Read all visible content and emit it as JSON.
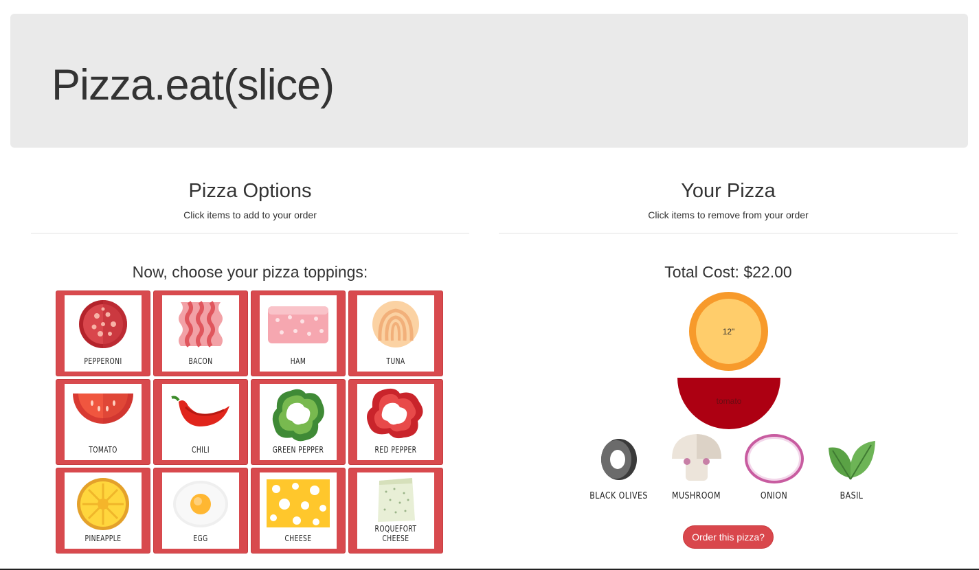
{
  "header": {
    "title": "Pizza.eat(slice)"
  },
  "options": {
    "title": "Pizza Options",
    "subtitle": "Click items to add to your order",
    "prompt": "Now, choose your pizza toppings:",
    "toppings": [
      {
        "label": "PEPPERONI",
        "icon": "pepperoni-icon"
      },
      {
        "label": "BACON",
        "icon": "bacon-icon"
      },
      {
        "label": "HAM",
        "icon": "ham-icon"
      },
      {
        "label": "TUNA",
        "icon": "tuna-icon"
      },
      {
        "label": "TOMATO",
        "icon": "tomato-icon"
      },
      {
        "label": "CHILI",
        "icon": "chili-icon"
      },
      {
        "label": "GREEN PEPPER",
        "icon": "green-pepper-icon"
      },
      {
        "label": "RED PEPPER",
        "icon": "red-pepper-icon"
      },
      {
        "label": "PINEAPPLE",
        "icon": "pineapple-icon"
      },
      {
        "label": "EGG",
        "icon": "egg-icon"
      },
      {
        "label": "CHEESE",
        "icon": "cheese-icon"
      },
      {
        "label": "ROQUEFORT CHEESE",
        "icon": "roquefort-cheese-icon"
      }
    ]
  },
  "your_pizza": {
    "title": "Your Pizza",
    "subtitle": "Click items to remove from your order",
    "total_cost": "Total Cost: $22.00",
    "size": "12\"",
    "sauce": "tomato",
    "chosen": [
      {
        "label": "BLACK OLIVES",
        "icon": "black-olive-icon"
      },
      {
        "label": "MUSHROOM",
        "icon": "mushroom-icon"
      },
      {
        "label": "ONION",
        "icon": "onion-icon"
      },
      {
        "label": "BASIL",
        "icon": "basil-icon"
      }
    ],
    "order_button": "Order this pizza?"
  },
  "colors": {
    "tile_red": "#d84a4e",
    "header_bg": "#eaeaea",
    "crust": "#f79a2b",
    "dough": "#ffcd6b",
    "sauce": "#ad0012"
  }
}
